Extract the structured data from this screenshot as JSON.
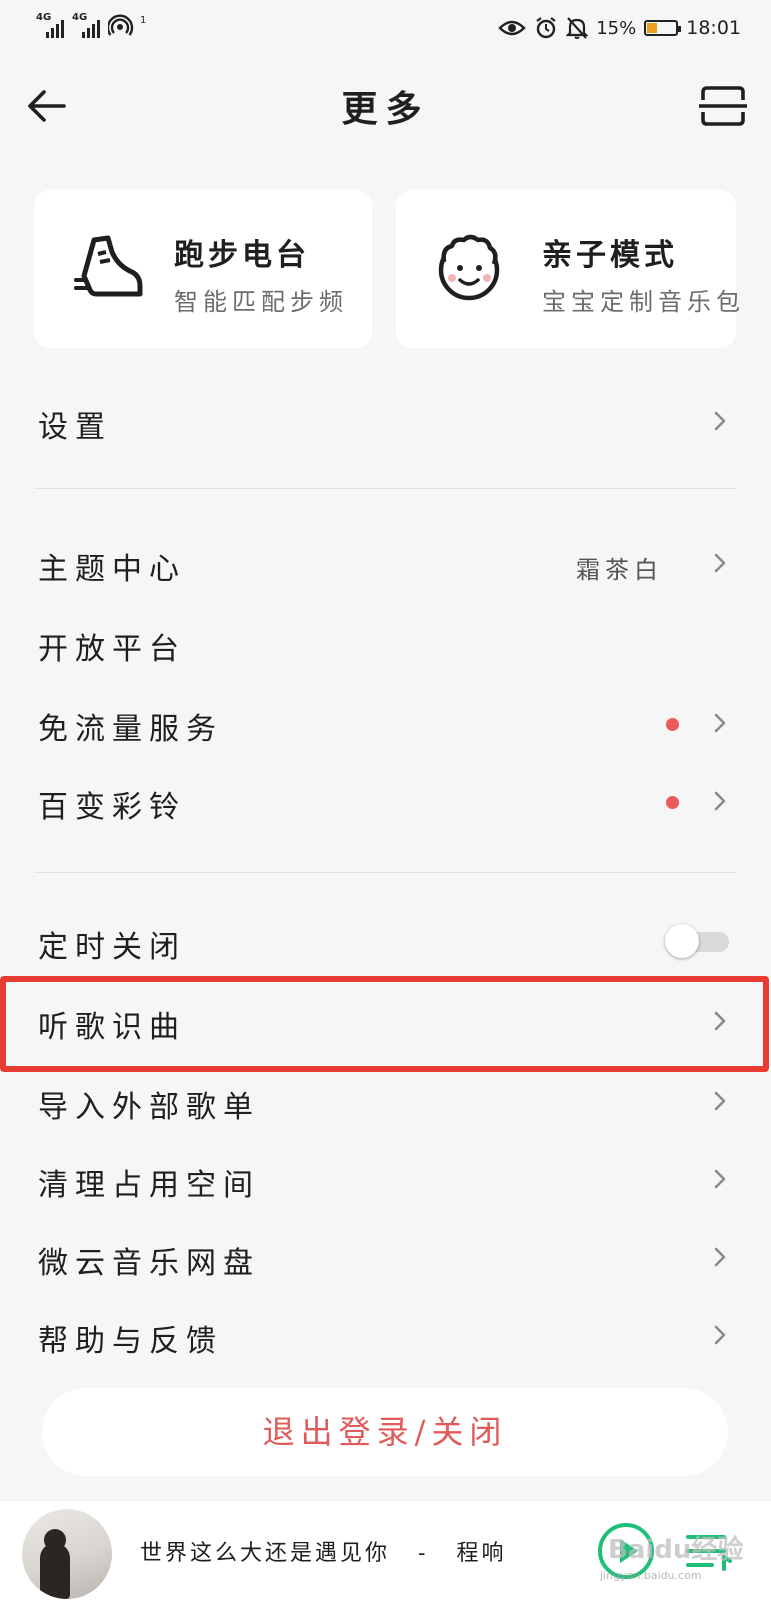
{
  "status_bar": {
    "signal1": "4G",
    "signal2": "4G",
    "hotspot_superscript": "1",
    "battery": "15%",
    "time": "18:01"
  },
  "header": {
    "title": "更多"
  },
  "cards": [
    {
      "title": "跑步电台",
      "subtitle": "智能匹配步频",
      "icon": "running-shoe-icon"
    },
    {
      "title": "亲子模式",
      "subtitle": "宝宝定制音乐包",
      "icon": "child-face-icon"
    }
  ],
  "menu": {
    "settings": "设置",
    "theme_center": "主题中心",
    "theme_value": "霜茶白",
    "open_platform": "开放平台",
    "free_data": "免流量服务",
    "ringtone": "百变彩铃",
    "timer_off": "定时关闭",
    "timer_off_enabled": false,
    "recognize_song": "听歌识曲",
    "import_playlist": "导入外部歌单",
    "clear_space": "清理占用空间",
    "weiyun_disk": "微云音乐网盘",
    "help_feedback": "帮助与反馈"
  },
  "logout_label": "退出登录/关闭",
  "player": {
    "song": "世界这么大还是遇见你",
    "separator": "-",
    "artist": "程响"
  },
  "watermark": {
    "text": "Baidu经验",
    "url": "jingyan.baidu.com"
  },
  "colors": {
    "highlight": "#e83b33",
    "red_dot": "#ec5b5b",
    "logout_text": "#e05a5a",
    "accent_green": "#1fbf7a"
  }
}
